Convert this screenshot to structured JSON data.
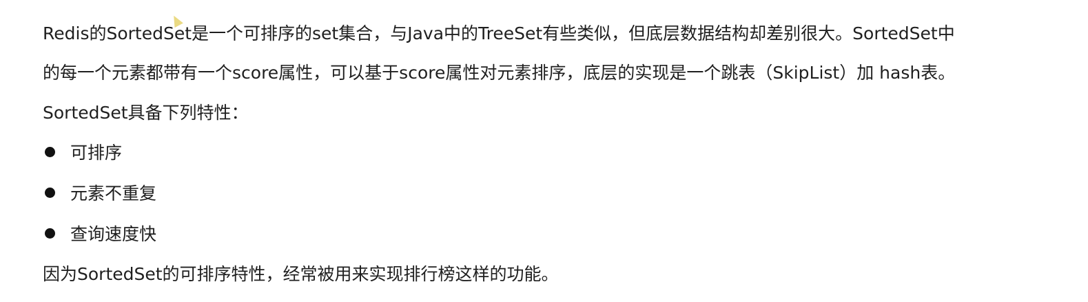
{
  "paragraphs": {
    "intro_line1": "Redis的SortedSet是一个可排序的set集合，与Java中的TreeSet有些类似，但底层数据结构却差别很大。SortedSet中",
    "intro_line2": "的每一个元素都带有一个score属性，可以基于score属性对元素排序，底层的实现是一个跳表（SkipList）加 hash表。",
    "features_heading": "SortedSet具备下列特性：",
    "conclusion": "因为SortedSet的可排序特性，经常被用来实现排行榜这样的功能。"
  },
  "features": [
    "可排序",
    "元素不重复",
    "查询速度快"
  ],
  "colors": {
    "text": "#1f1f1f",
    "bullet": "#111111",
    "cursor": "#e8d676"
  },
  "icons": {
    "cursor": "mouse-pointer-icon",
    "bullet": "filled-circle-bullet"
  }
}
